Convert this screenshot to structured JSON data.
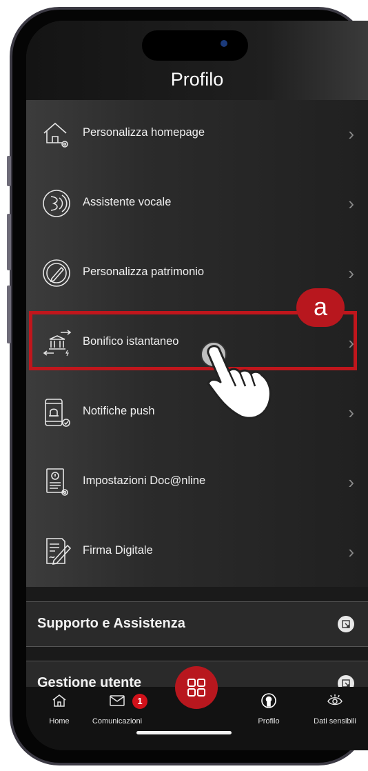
{
  "header": {
    "title": "Profilo"
  },
  "menu": [
    {
      "label": "Personalizza homepage",
      "icon": "home-gear-icon"
    },
    {
      "label": "Assistente vocale",
      "icon": "voice-assistant-icon"
    },
    {
      "label": "Personalizza patrimonio",
      "icon": "pencil-circle-icon"
    },
    {
      "label": "Bonifico istantaneo",
      "icon": "bank-transfer-icon"
    },
    {
      "label": "Notifiche push",
      "icon": "phone-bell-icon"
    },
    {
      "label": "Impostazioni Doc@nline",
      "icon": "document-gear-icon"
    },
    {
      "label": "Firma Digitale",
      "icon": "signature-icon"
    }
  ],
  "sections": [
    {
      "label": "Supporto e Assistenza"
    },
    {
      "label": "Gestione utente"
    }
  ],
  "tabs": [
    {
      "label": "Home",
      "icon": "home-icon"
    },
    {
      "label": "Comunicazioni",
      "icon": "mail-icon",
      "badge": "1"
    },
    {
      "label": "",
      "icon": "apps-grid-icon"
    },
    {
      "label": "Profilo",
      "icon": "profile-icon"
    },
    {
      "label": "Dati sensibili",
      "icon": "eye-icon"
    }
  ],
  "annotation": {
    "label": "a"
  },
  "colors": {
    "accent": "#b8171e",
    "background": "#1a1a1a"
  }
}
